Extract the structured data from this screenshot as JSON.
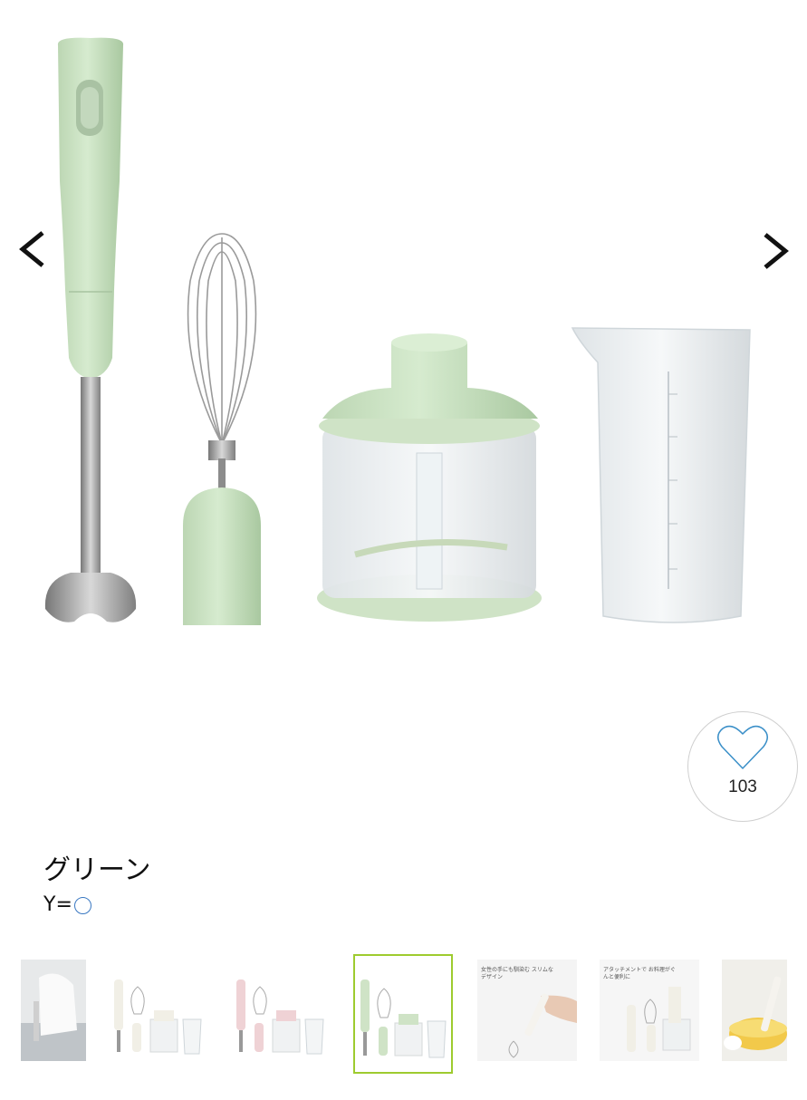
{
  "gallery": {
    "prev_icon": "chevron-left-icon",
    "next_icon": "chevron-right-icon"
  },
  "favorite": {
    "icon": "heart-outline-icon",
    "count": "103"
  },
  "variant": {
    "name": "グリーン",
    "code_prefix": "Y="
  },
  "thumbnails": [
    {
      "label": ""
    },
    {
      "label": ""
    },
    {
      "label": ""
    },
    {
      "label": ""
    },
    {
      "label": "女性の手にも馴染む スリムなデザイン"
    },
    {
      "label": "アタッチメントで お料理がぐんと便利に"
    },
    {
      "label": ""
    }
  ],
  "colors": {
    "mint": "#cfe3c6",
    "selected_border": "#9ecb2f",
    "heart_stroke": "#3a8fc8"
  }
}
